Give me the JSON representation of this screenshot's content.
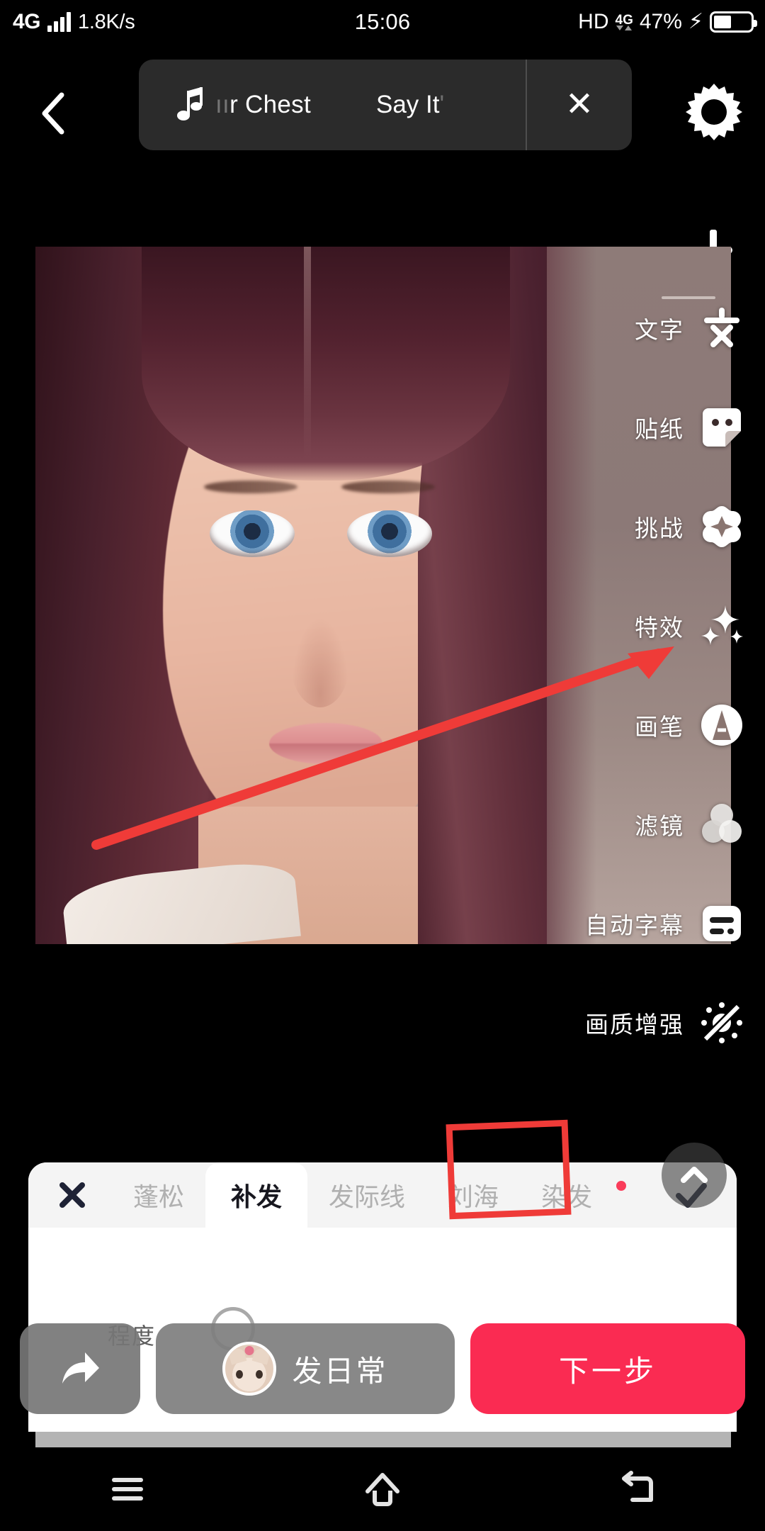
{
  "statusbar": {
    "network": "4G",
    "speed": "1.8K/s",
    "clock": "15:06",
    "hd": "HD",
    "volte": "4G",
    "battery_pct": "47%",
    "battery_level": 47,
    "charging_icon": "⚡"
  },
  "topbar": {
    "back_icon": "chevron-left-icon",
    "music": {
      "note_icon": "music-note-icon",
      "title_faded": "ıı",
      "title": "r Chest",
      "artist": "Say It",
      "artist_tail": "'",
      "close_label": "✕"
    },
    "settings_icon": "gear-icon",
    "download_icon": "download-icon"
  },
  "rail": {
    "items": [
      {
        "id": "text",
        "label": "文字",
        "icon": "text-wen-icon"
      },
      {
        "id": "sticker",
        "label": "贴纸",
        "icon": "sticker-icon"
      },
      {
        "id": "challenge",
        "label": "挑战",
        "icon": "challenge-star-icon"
      },
      {
        "id": "effect",
        "label": "特效",
        "icon": "sparkles-icon"
      },
      {
        "id": "brush",
        "label": "画笔",
        "icon": "brush-circle-icon"
      },
      {
        "id": "filter",
        "label": "滤镜",
        "icon": "filter-circles-icon"
      },
      {
        "id": "caption",
        "label": "自动字幕",
        "icon": "auto-caption-icon"
      },
      {
        "id": "quality",
        "label": "画质增强",
        "icon": "quality-enhance-off-icon"
      }
    ]
  },
  "sheet": {
    "close_icon": "close-x-icon",
    "confirm_icon": "check-icon",
    "collapse_icon": "chevron-up-icon",
    "tabs": [
      {
        "label": "蓬松",
        "active": false
      },
      {
        "label": "补发",
        "active": true
      },
      {
        "label": "发际线",
        "active": false
      },
      {
        "label": "刘海",
        "active": false
      },
      {
        "label": "染发",
        "active": false
      }
    ],
    "degree_label": "程度"
  },
  "actionbar": {
    "share_icon": "share-arrow-icon",
    "daily_label": "发日常",
    "avatar_icon": "cat-avatar",
    "next_label": "下一步"
  },
  "navbar": {
    "menu_icon": "menu-icon",
    "home_icon": "home-icon",
    "back_icon": "back-arrow-icon"
  },
  "annotations": {
    "arrow": "red-arrow-pointing-to-filter",
    "rect": "red-rectangle-around-collapse-button"
  },
  "colors": {
    "accent_red": "#fa2b52",
    "annotation_red": "#ef3b38",
    "sheet_bg": "#ffffff",
    "tab_bar_bg": "#f4f4f4",
    "pill_bg": "#2b2b2b"
  }
}
